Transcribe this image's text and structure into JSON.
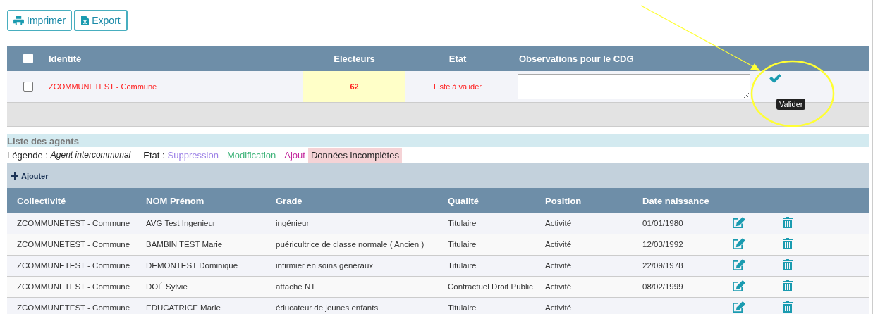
{
  "toolbar": {
    "buttons": [
      {
        "kind": "print",
        "label": "Imprimer"
      },
      {
        "kind": "export",
        "label": "Export"
      }
    ]
  },
  "summary_table": {
    "header_checkbox": {
      "checked": false
    },
    "columns": [
      "Identité",
      "Electeurs",
      "Etat",
      "Observations pour le CDG"
    ],
    "rows": [
      {
        "checked": false,
        "identity": "ZCOMMUNETEST - Commune",
        "electeurs": "62",
        "etat": "Liste à valider",
        "validate_tooltip": "Valider"
      }
    ]
  },
  "agents": {
    "title": "Liste des agents",
    "legend": {
      "label": "Légende :",
      "agent_type": "Agent intercommunal",
      "state_label": "Etat :",
      "states": [
        {
          "label": "Suppression",
          "kind": "text",
          "color": "#9b7fe6"
        },
        {
          "label": "Modification",
          "kind": "text",
          "color": "#3fb47a"
        },
        {
          "label": "Ajout",
          "kind": "text",
          "color": "#c3269c"
        },
        {
          "label": "Données incomplètes",
          "kind": "fill",
          "color": "#f5d3d6"
        }
      ]
    },
    "add_button": "Ajouter",
    "columns": [
      "Collectivité",
      "NOM Prénom",
      "Grade",
      "Qualité",
      "Position",
      "Date naissance"
    ],
    "rows": [
      {
        "collectivite": "ZCOMMUNETEST - Commune",
        "nom": "AVG Test Ingenieur",
        "grade": "ingénieur",
        "qualite": "Titulaire",
        "position": "Activité",
        "date": "01/01/1980"
      },
      {
        "collectivite": "ZCOMMUNETEST - Commune",
        "nom": "BAMBIN TEST Marie",
        "grade": "puéricultrice de classe normale ( Ancien )",
        "qualite": "Titulaire",
        "position": "Activité",
        "date": "12/03/1992"
      },
      {
        "collectivite": "ZCOMMUNETEST - Commune",
        "nom": "DEMONTEST Dominique",
        "grade": "infirmier en soins généraux",
        "qualite": "Titulaire",
        "position": "Activité",
        "date": "22/09/1978"
      },
      {
        "collectivite": "ZCOMMUNETEST - Commune",
        "nom": "DOÉ Sylvie",
        "grade": "attaché NT",
        "qualite": "Contractuel Droit Public",
        "position": "Activité",
        "date": "08/02/1999"
      },
      {
        "collectivite": "ZCOMMUNETEST - Commune",
        "nom": "EDUCATRICE Marie",
        "grade": "éducateur de jeunes enfants",
        "qualite": "Titulaire",
        "position": "Activité"
      }
    ]
  }
}
